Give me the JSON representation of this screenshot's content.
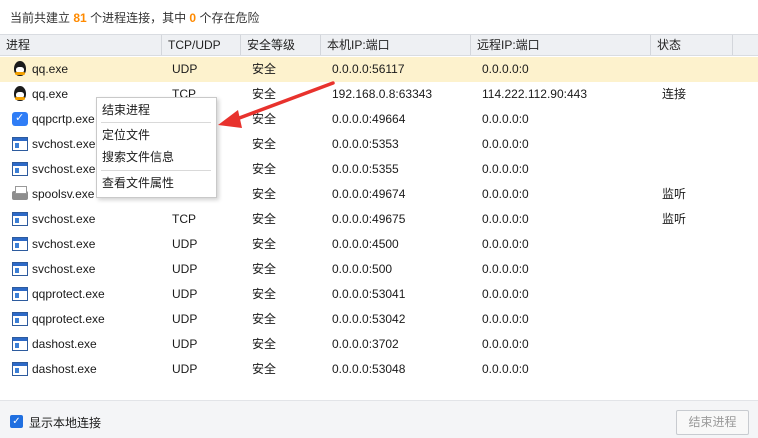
{
  "summary": {
    "prefix": "当前共建立",
    "count": "81",
    "mid": "个进程连接，其中",
    "danger_count": "0",
    "suffix": "个存在危险"
  },
  "columns": [
    "进程",
    "TCP/UDP",
    "安全等级",
    "本机IP:端口",
    "远程IP:端口",
    "状态"
  ],
  "rows": [
    {
      "icon": "qq-penguin-icon",
      "process": "qq.exe",
      "proto": "UDP",
      "level": "安全",
      "local": "0.0.0.0:56117",
      "remote": "0.0.0.0:0",
      "status": ""
    },
    {
      "icon": "qq-penguin-icon",
      "process": "qq.exe",
      "proto": "TCP",
      "level": "安全",
      "local": "192.168.0.8:63343",
      "remote": "114.222.112.90:443",
      "status": "连接"
    },
    {
      "icon": "shield-check-icon",
      "process": "qqpcrtp.exe",
      "proto": "",
      "level": "安全",
      "local": "0.0.0.0:49664",
      "remote": "0.0.0.0:0",
      "status": ""
    },
    {
      "icon": "window-app-icon",
      "process": "svchost.exe",
      "proto": "",
      "level": "安全",
      "local": "0.0.0.0:5353",
      "remote": "0.0.0.0:0",
      "status": ""
    },
    {
      "icon": "window-app-icon",
      "process": "svchost.exe",
      "proto": "",
      "level": "安全",
      "local": "0.0.0.0:5355",
      "remote": "0.0.0.0:0",
      "status": ""
    },
    {
      "icon": "printer-icon",
      "process": "spoolsv.exe",
      "proto": "TCP",
      "level": "安全",
      "local": "0.0.0.0:49674",
      "remote": "0.0.0.0:0",
      "status": "监听"
    },
    {
      "icon": "window-app-icon",
      "process": "svchost.exe",
      "proto": "TCP",
      "level": "安全",
      "local": "0.0.0.0:49675",
      "remote": "0.0.0.0:0",
      "status": "监听"
    },
    {
      "icon": "window-app-icon",
      "process": "svchost.exe",
      "proto": "UDP",
      "level": "安全",
      "local": "0.0.0.0:4500",
      "remote": "0.0.0.0:0",
      "status": ""
    },
    {
      "icon": "window-app-icon",
      "process": "svchost.exe",
      "proto": "UDP",
      "level": "安全",
      "local": "0.0.0.0:500",
      "remote": "0.0.0.0:0",
      "status": ""
    },
    {
      "icon": "window-app-icon",
      "process": "qqprotect.exe",
      "proto": "UDP",
      "level": "安全",
      "local": "0.0.0.0:53041",
      "remote": "0.0.0.0:0",
      "status": ""
    },
    {
      "icon": "window-app-icon",
      "process": "qqprotect.exe",
      "proto": "UDP",
      "level": "安全",
      "local": "0.0.0.0:53042",
      "remote": "0.0.0.0:0",
      "status": ""
    },
    {
      "icon": "window-app-icon",
      "process": "dashost.exe",
      "proto": "UDP",
      "level": "安全",
      "local": "0.0.0.0:3702",
      "remote": "0.0.0.0:0",
      "status": ""
    },
    {
      "icon": "window-app-icon",
      "process": "dashost.exe",
      "proto": "UDP",
      "level": "安全",
      "local": "0.0.0.0:53048",
      "remote": "0.0.0.0:0",
      "status": ""
    }
  ],
  "context_menu": {
    "items": [
      "结束进程",
      "定位文件",
      "搜索文件信息",
      "查看文件属性"
    ]
  },
  "annotation": {
    "color": "#e8322d"
  },
  "footer": {
    "checkbox_label": "显示本地连接",
    "checkbox_checked": true,
    "end_button": "结束进程"
  },
  "colors": {
    "accent": "#1f6fe0",
    "highlight": "#ff8a00",
    "selected_row": "#fdf2cd"
  }
}
